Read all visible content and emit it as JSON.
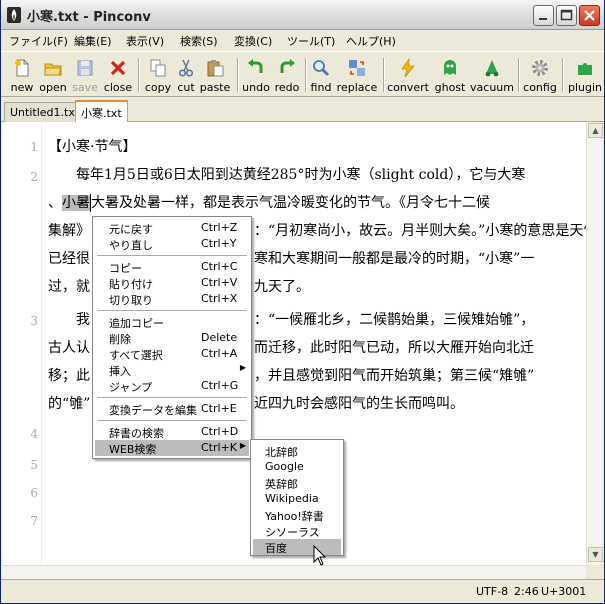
{
  "window": {
    "title": "小寒.txt - Pinconv"
  },
  "menu": [
    "ファイル(F)",
    "編集(E)",
    "表示(V)",
    "検索(S)",
    "変換(C)",
    "ツール(T)",
    "ヘルプ(H)"
  ],
  "toolbar": [
    {
      "label": "new",
      "icon": "new-file-icon",
      "disabled": false
    },
    {
      "label": "open",
      "icon": "folder-icon",
      "disabled": false
    },
    {
      "label": "save",
      "icon": "disk-icon",
      "disabled": true
    },
    {
      "label": "close",
      "icon": "close-x-icon",
      "disabled": false
    },
    {
      "label": "copy",
      "icon": "copy-icon",
      "disabled": false
    },
    {
      "label": "cut",
      "icon": "scissors-icon",
      "disabled": false
    },
    {
      "label": "paste",
      "icon": "clipboard-icon",
      "disabled": false
    },
    {
      "label": "undo",
      "icon": "undo-arrow-icon",
      "disabled": false
    },
    {
      "label": "redo",
      "icon": "redo-arrow-icon",
      "disabled": false
    },
    {
      "label": "find",
      "icon": "magnifier-icon",
      "disabled": false
    },
    {
      "label": "replace",
      "icon": "replace-icon",
      "disabled": false
    },
    {
      "label": "convert",
      "icon": "lightning-icon",
      "disabled": false
    },
    {
      "label": "ghost",
      "icon": "ghost-icon",
      "disabled": false
    },
    {
      "label": "vacuum",
      "icon": "vacuum-icon",
      "disabled": false
    },
    {
      "label": "config",
      "icon": "gear-icon",
      "disabled": false
    },
    {
      "label": "plugin",
      "icon": "puzzle-icon",
      "disabled": false
    }
  ],
  "tabs": [
    {
      "label": "Untitled1.txt",
      "active": false
    },
    {
      "label": "小寒.txt",
      "active": true
    }
  ],
  "editor": {
    "line_numbers": [
      "1",
      "2",
      "3",
      "4",
      "5",
      "6",
      "7"
    ],
    "lines": [
      {
        "t": "【小寒·节气】"
      },
      {
        "t": "　　每年1月5日或6日太阳到达黄经285°时为小寒（slight cold），它与大寒"
      },
      {
        "t_sel": "小暑",
        "t_pre": "、",
        "t_post": "大暑及处暑一样，都是表示气温冷暖变化的节气。《月令七十二候"
      },
      {
        "t": "集解》"
      },
      {
        "t": "已经很"
      },
      {
        "t": "过，就"
      },
      {
        "t": "　　我"
      },
      {
        "t": "古人认"
      },
      {
        "t": "移；此"
      },
      {
        "t": "的“雊”"
      }
    ],
    "right_fragments": [
      "：“月初寒尚小，故云。月半则大矣。”小寒的意思是天气",
      "寒和大寒期间一般都是最冷的时期，“小寒”一",
      "九天了。",
      "：“一候雁北乡，二候鹊始巢，三候雉始雊”，",
      "而迁移，此时阳气已动，所以大雁开始向北迁",
      "，并且感觉到阳气而开始筑巢；第三候“雉雊”",
      "近四九时会感阳气的生长而鸣叫。"
    ]
  },
  "context_menu": [
    {
      "label": "元に戻す",
      "key": "Ctrl+Z"
    },
    {
      "label": "やり直し",
      "key": "Ctrl+Y"
    },
    {
      "sep": true
    },
    {
      "label": "コピー",
      "key": "Ctrl+C"
    },
    {
      "label": "貼り付け",
      "key": "Ctrl+V"
    },
    {
      "label": "切り取り",
      "key": "Ctrl+X"
    },
    {
      "sep": true
    },
    {
      "label": "追加コピー",
      "key": ""
    },
    {
      "label": "削除",
      "key": "Delete"
    },
    {
      "label": "すべて選択",
      "key": "Ctrl+A"
    },
    {
      "label": "挿入",
      "key": "",
      "submenu": true
    },
    {
      "label": "ジャンプ",
      "key": "Ctrl+G"
    },
    {
      "sep": true
    },
    {
      "label": "変換データを編集",
      "key": "Ctrl+E"
    },
    {
      "sep": true
    },
    {
      "label": "辞書の検索",
      "key": "Ctrl+D"
    },
    {
      "label": "WEB検索",
      "key": "Ctrl+K",
      "submenu": true,
      "highlight": true
    }
  ],
  "submenu": [
    {
      "label": "北辞郎",
      "highlight": false
    },
    {
      "label": "Google",
      "highlight": false
    },
    {
      "label": "英辞郎",
      "highlight": false
    },
    {
      "label": "Wikipedia",
      "highlight": false
    },
    {
      "label": "Yahoo!辞書",
      "highlight": false
    },
    {
      "label": "シソーラス",
      "highlight": false
    },
    {
      "label": "百度",
      "highlight": true
    }
  ],
  "status": {
    "encoding": "UTF-8",
    "position": "2:46",
    "codepoint": "U+3001"
  }
}
